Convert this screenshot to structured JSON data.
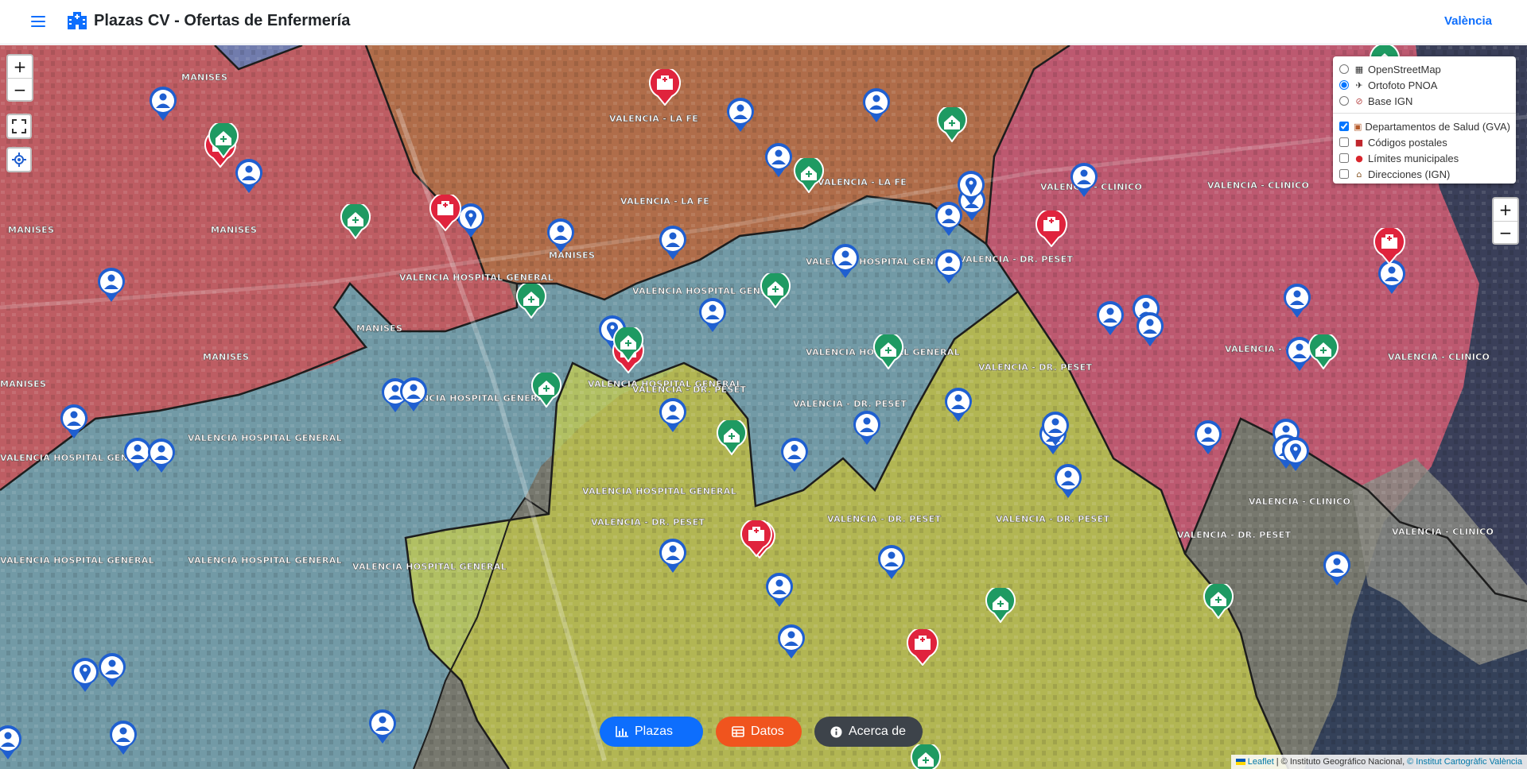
{
  "header": {
    "title": "Plazas CV - Ofertas de Enfermería",
    "region": "València"
  },
  "layers": {
    "base": [
      {
        "label": "OpenStreetMap",
        "icon": "map-icon",
        "checked": false
      },
      {
        "label": "Ortofoto PNOA",
        "icon": "satellite-icon",
        "checked": true
      },
      {
        "label": "Base IGN",
        "icon": "compass-icon",
        "checked": false
      }
    ],
    "overlays": [
      {
        "label": "Departamentos de Salud (GVA)",
        "icon": "hospital-icon",
        "checked": true
      },
      {
        "label": "Códigos postales",
        "icon": "mailbox-icon",
        "checked": false
      },
      {
        "label": "Límites municipales",
        "icon": "pin-icon",
        "checked": false
      },
      {
        "label": "Direcciones (IGN)",
        "icon": "house-icon",
        "checked": false
      }
    ]
  },
  "map_labels": [
    "MANISES",
    "VALENCIA - LA FE",
    "VALENCIA HOSPITAL GENERAL",
    "VALENCIA - CLINICO",
    "VALENCIA - DR. PESET"
  ],
  "controls": {
    "zoom_in": "+",
    "zoom_out": "−"
  },
  "buttons": {
    "plazas": "Plazas",
    "datos": "Datos",
    "acerca": "Acerca de"
  },
  "attribution": {
    "leaflet": "Leaflet",
    "ign": "| © Instituto Geográfico Nacional,",
    "icv": "© Institut Cartogràfic València"
  },
  "colors": {
    "manises": "#d9535f",
    "la_fe": "#c66a3d",
    "hospital_general": "#6fb0c8",
    "dr_peset": "#c9cf4a",
    "clinico": "#d84d72",
    "nurse_marker": "#1f5fd0",
    "hospital_marker": "#e0233d",
    "center_marker": "#1e9a62",
    "accent": "#0d6efd"
  }
}
